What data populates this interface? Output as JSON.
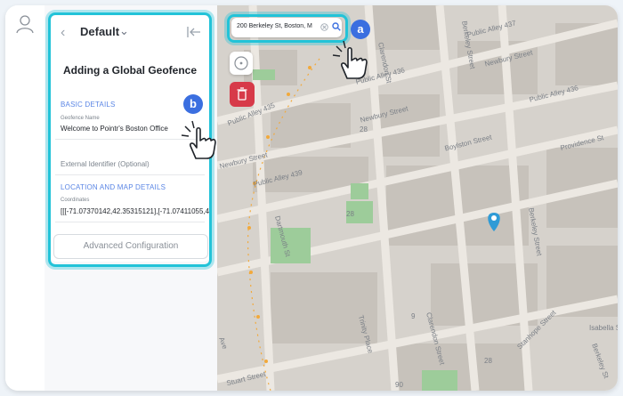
{
  "rail": {
    "user_icon": "user-icon"
  },
  "panel": {
    "back_icon": "‹",
    "selector_label": "Default",
    "chevron_icon": "⌄",
    "collapse_icon": "collapse-left-icon",
    "title": "Adding a Global Geofence",
    "basic_details_heading": "BASIC DETAILS",
    "geofence_name_label": "Geofence Name",
    "geofence_name_value": "Welcome to Pointr's Boston Office",
    "external_identifier_placeholder": "External Identifier (Optional)",
    "location_heading": "LOCATION AND MAP DETAILS",
    "coordinates_label": "Coordinates",
    "coordinates_value": "[[[-71.07370142,42.35315121],[-71.07411055,4",
    "advanced_button": "Advanced Configuration"
  },
  "callouts": {
    "a": "a",
    "b": "b"
  },
  "map": {
    "search_value": "200 Berkeley St, Boston, M",
    "streets": {
      "public_alley_437": "Public Alley 437",
      "newbury_street_top": "Newbury Street",
      "public_alley_436": "Public Alley 436",
      "public_alley_435": "Public Alley 435",
      "newbury_street_mid": "Newbury Street",
      "berkeley_street_top": "Berkeley Street",
      "boylston_street": "Boylston Street",
      "providence_st": "Providence St",
      "newbury_street_left": "Newbury Street",
      "public_alley_439": "Public Alley 439",
      "dartmouth_st": "Dartmouth St",
      "berkeley_street_right": "Berkeley Street",
      "clarendon_st_upper": "Clarendon St",
      "trinity_place": "Trinity Place",
      "clarendon_street_lower": "Clarendon Street",
      "stanhope_street": "Stanhope Street",
      "stuart_street": "Stuart Street",
      "ave_partial": "Ave",
      "berkeley_street_corner": "Berkeley St",
      "isabella_partial": "Isabella S",
      "num_28_a": "28",
      "num_28_b": "28",
      "num_28_c": "28",
      "num_9": "9",
      "num_90": "90"
    },
    "colors": {
      "highlight": "#22c3d8",
      "badge": "#3b6fe0",
      "pin": "#2f9bd6",
      "geofence": "#f2a93b",
      "delete": "#d73a49"
    }
  }
}
